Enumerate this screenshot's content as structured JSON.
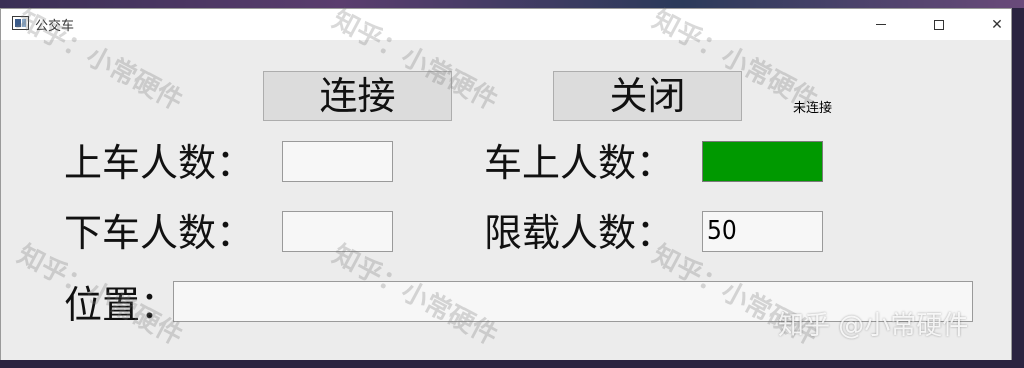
{
  "window": {
    "title": "公交车"
  },
  "toolbar": {
    "connect_label": "连接",
    "close_label": "关闭",
    "connection_status": "未连接"
  },
  "form": {
    "board_label": "上车人数：",
    "board_value": "",
    "onbus_label": "车上人数：",
    "onbus_value": "",
    "alight_label": "下车人数：",
    "alight_value": "",
    "limit_label": "限载人数：",
    "limit_value": "50",
    "position_label": "位置：",
    "position_value": ""
  },
  "indicator": {
    "onbus_color": "#009900"
  },
  "watermark": {
    "repeated": "知乎：小常硬件",
    "corner": "知乎 @小常硬件"
  },
  "icons": [
    "app-icon",
    "minimize-icon",
    "maximize-icon",
    "close-icon"
  ]
}
